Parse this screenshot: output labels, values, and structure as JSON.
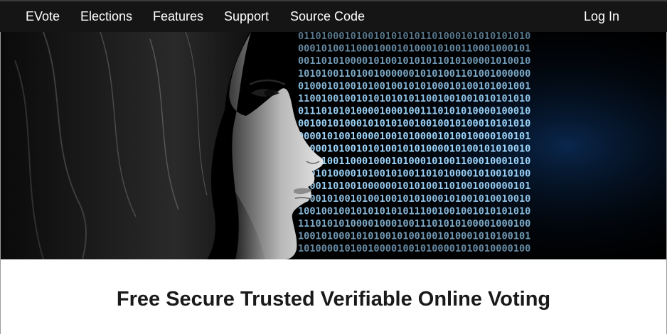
{
  "nav": {
    "brand": "EVote",
    "items": [
      {
        "label": "Elections"
      },
      {
        "label": "Features"
      },
      {
        "label": "Support"
      },
      {
        "label": "Source Code"
      }
    ],
    "login": "Log In"
  },
  "hero": {
    "image": "woman-profile-binary-code",
    "binary_rows": [
      "0110100010100101010101101000101010101010",
      "0001010011000100010100010100110001000101",
      "0011010100001010010101011010100001010010",
      "1010100110100100000010101001101001000000",
      "0100010100101001001010100010100101001001",
      "1100100100101010101011001001001010101010",
      "0111010101000010001001110101010000100010",
      "0010010100010101010010010010100010101010",
      "0000101001000010010100001010010000100101",
      "1000010100101010010101000010100101010010",
      "0010100110001000101000101001100010001010",
      "1101010000101001010011010100001010010100",
      "0100110100100000010101001101001000000101",
      "1000101001010010010101000101001010010010",
      "1001001001010101010111001001001010101010",
      "1110101010000100010011101010100001000100",
      "1001010001010100101001001010001010100101",
      "1010000101001000010010100001010010000100"
    ],
    "colors": {
      "binary_bright": "#9fd8ff",
      "binary_dim": "#1a5fb4",
      "background": "#000000"
    }
  },
  "main": {
    "tagline": "Free Secure Trusted Verifiable Online Voting"
  },
  "colors": {
    "navbar": "#151515",
    "nav_text": "#ffffff",
    "tagline": "#1a1a1a"
  }
}
